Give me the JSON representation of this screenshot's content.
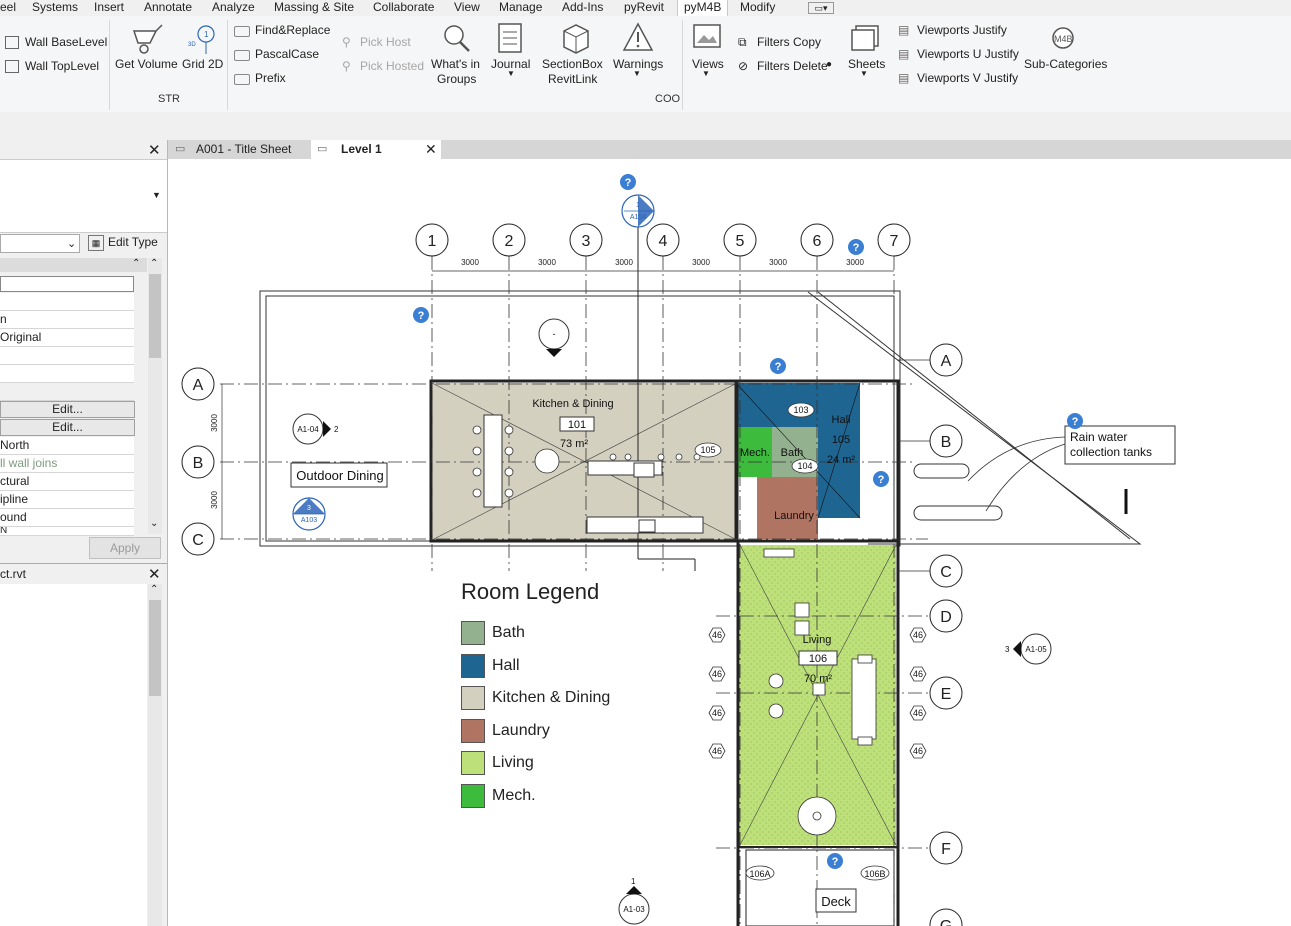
{
  "menubar": {
    "items": [
      "eel",
      "Systems",
      "Insert",
      "Annotate",
      "Analyze",
      "Massing & Site",
      "Collaborate",
      "View",
      "Manage",
      "Add-Ins",
      "pyRevit",
      "pyM4B",
      "Modify"
    ],
    "active": "pyM4B"
  },
  "ribbon": {
    "wall_base": "Wall BaseLevel",
    "wall_top": "Wall TopLevel",
    "get_volume": "Get Volume",
    "grid2d": "Grid 2D",
    "str_label": "STR",
    "find_replace": "Find&Replace",
    "pascal_case": "PascalCase",
    "prefix": "Prefix",
    "pick_host": "Pick Host",
    "pick_hosted": "Pick Hosted",
    "whats_in_groups_1": "What's in",
    "whats_in_groups_2": "Groups",
    "journal": "Journal",
    "sectionbox_1": "SectionBox",
    "sectionbox_2": "RevitLink",
    "warnings": "Warnings",
    "coo_label": "COO",
    "views": "Views",
    "filters_copy": "Filters Copy",
    "filters_delete": "Filters Delete",
    "sheets": "Sheets",
    "vp_justify": "Viewports Justify",
    "vp_u_justify": "Viewports U Justify",
    "vp_v_justify": "Viewports V Justify",
    "sub_categories": "Sub-Categories"
  },
  "properties": {
    "edit_type": "Edit Type",
    "rows": [
      "",
      "",
      "n",
      "Original",
      "",
      "",
      "",
      "",
      "North",
      "ll wall joins",
      "ctural",
      "ipline",
      "ound",
      "N"
    ],
    "edit_label": "Edit...",
    "apply": "Apply"
  },
  "browser": {
    "title": "ct.rvt"
  },
  "tabs": [
    {
      "label": "A001 - Title Sheet"
    },
    {
      "label": "Level 1"
    }
  ],
  "plan": {
    "grid_numbers": [
      "1",
      "2",
      "3",
      "4",
      "5",
      "6",
      "7"
    ],
    "grid_letters_left": [
      "A",
      "B",
      "C"
    ],
    "grid_letters_right": [
      "A",
      "B",
      "C",
      "D",
      "E",
      "F",
      "G"
    ],
    "dims_top": [
      "3000",
      "3000",
      "3000",
      "3000",
      "3000",
      "3000"
    ],
    "dims_left": [
      "3000",
      "3000"
    ],
    "outdoor_dining": "Outdoor Dining",
    "kitchen_name": "Kitchen & Dining",
    "kitchen_num": "101",
    "kitchen_area": "73 m²",
    "hall_name": "Hall",
    "hall_num": "105",
    "hall_area": "24 m²",
    "mech_name": "Mech.",
    "bath_name": "Bath",
    "laundry_name": "Laundry",
    "living_name": "Living",
    "living_num": "106",
    "living_area": "70 m²",
    "deck": "Deck",
    "rain_water_1": "Rain water",
    "rain_water_2": "collection tanks",
    "door_103": "103",
    "door_104": "104",
    "door_105": "105",
    "door_106a": "106A",
    "door_106b": "106B",
    "tag_46": "46",
    "sec_a104_num": "1",
    "sec_a104_ref": "A104",
    "sec_a103_num": "3",
    "sec_a103_ref": "A103",
    "elev_a104_ref": "A1-04",
    "elev_a104_num": "2",
    "elev_a105_ref": "A1-05",
    "elev_a105_num": "3",
    "elev_a103_ref": "A1-03",
    "elev_a103_num": "1",
    "dash": "-",
    "question": "?"
  },
  "legend": {
    "title": "Room Legend",
    "items": [
      {
        "label": "Bath",
        "color": "#93b18f"
      },
      {
        "label": "Hall",
        "color": "#1f6591"
      },
      {
        "label": "Kitchen & Dining",
        "color": "#d4d0bf"
      },
      {
        "label": "Laundry",
        "color": "#b07462"
      },
      {
        "label": "Living",
        "color": "#bde07a"
      },
      {
        "label": "Mech.",
        "color": "#3dbb3d"
      }
    ]
  }
}
